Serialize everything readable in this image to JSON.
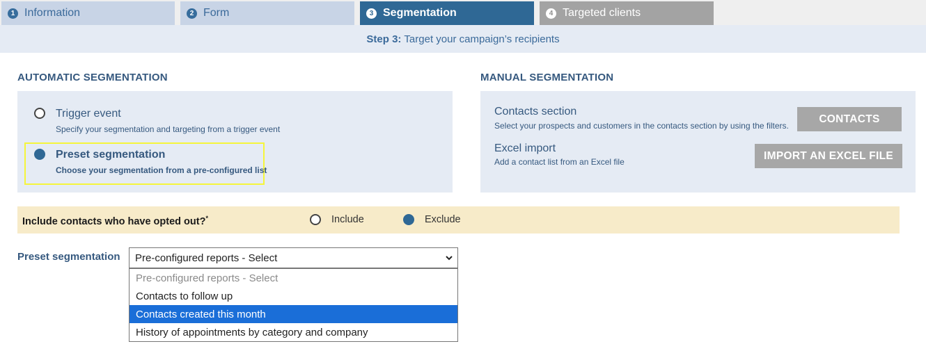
{
  "tabs": [
    {
      "num": "1",
      "label": "Information"
    },
    {
      "num": "2",
      "label": "Form"
    },
    {
      "num": "3",
      "label": "Segmentation"
    },
    {
      "num": "4",
      "label": "Targeted clients"
    }
  ],
  "step": {
    "prefix": "Step 3:",
    "text": "Target your campaign’s recipients"
  },
  "automatic": {
    "title": "AUTOMATIC SEGMENTATION",
    "options": [
      {
        "label": "Trigger event",
        "desc": "Specify your segmentation and targeting from a trigger event",
        "selected": false
      },
      {
        "label": "Preset segmentation",
        "desc": "Choose your segmentation from a pre-configured list",
        "selected": true
      }
    ]
  },
  "manual": {
    "title": "MANUAL SEGMENTATION",
    "contacts": {
      "label": "Contacts section",
      "desc": "Select your prospects and customers in the contacts section by using the filters.",
      "button": "CONTACTS"
    },
    "excel": {
      "label": "Excel import",
      "desc": "Add a contact list from an Excel file",
      "button": "IMPORT AN EXCEL FILE"
    }
  },
  "optout": {
    "label": "Include contacts who have opted out?",
    "required_mark": "*",
    "include": "Include",
    "exclude": "Exclude",
    "selected": "exclude"
  },
  "preset": {
    "label": "Preset segmentation",
    "selected_value": "Pre-configured reports - Select",
    "options": [
      "Pre-configured reports - Select",
      "Contacts to follow up",
      "Contacts created this month",
      "History of appointments by category and company"
    ],
    "highlighted_index": 2
  },
  "colors": {
    "accent": "#2f6895",
    "panel": "#e5ebf4",
    "optout_bg": "#f7ebc9",
    "highlight": "#f5f53a"
  }
}
